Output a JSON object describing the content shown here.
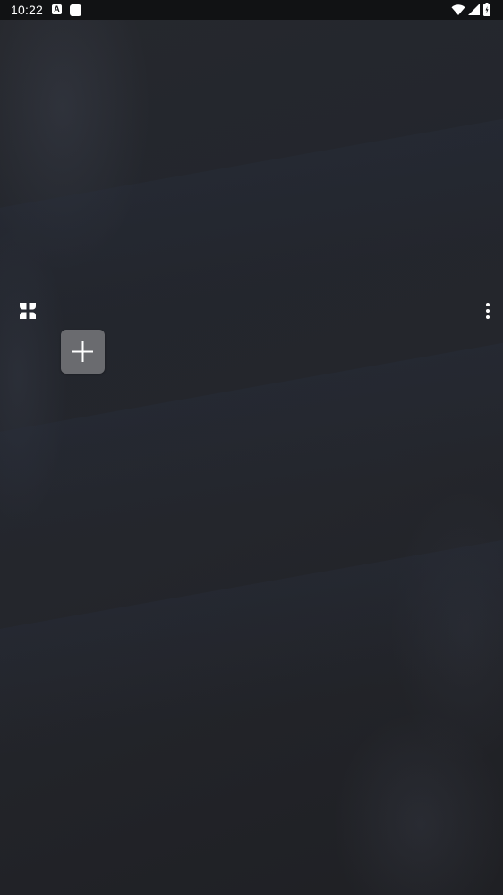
{
  "status_bar": {
    "time": "10:22",
    "notification_icons": [
      "a-notification-icon",
      "app-notification-icon"
    ],
    "system_icons": [
      "wifi-icon",
      "cellular-signal-icon",
      "battery-icon"
    ]
  },
  "home": {
    "app_drawer_icon": "app-drawer-icon",
    "more_options_icon": "more-vertical-icon",
    "add_tile_icon": "plus-icon"
  },
  "colors": {
    "status_bar_bg": "#111214",
    "wallpaper_base": "#24262c",
    "add_tile_bg": "#6a6b6f",
    "icon_color": "#ffffff"
  }
}
